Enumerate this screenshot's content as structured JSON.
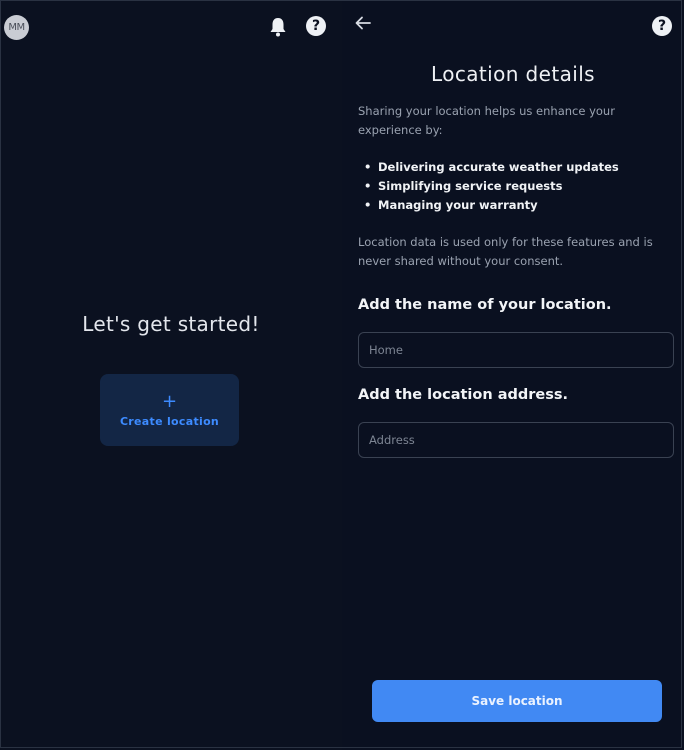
{
  "left_panel": {
    "avatar_initials": "MM",
    "heading": "Let's get started!",
    "create_button": {
      "icon": "plus-icon",
      "label": "Create location"
    }
  },
  "right_panel": {
    "title": "Location details",
    "intro": "Sharing your location helps us enhance your experience by:",
    "bullets": [
      "Delivering accurate weather updates",
      "Simplifying service requests",
      "Managing your warranty"
    ],
    "note": "Location data is used only for these features and is never shared without your consent.",
    "name_section": {
      "label": "Add the name of your location.",
      "placeholder": "Home",
      "value": ""
    },
    "address_section": {
      "label": "Add the location address.",
      "placeholder": "Address",
      "value": ""
    },
    "save_button": "Save location"
  },
  "colors": {
    "background": "#0b1120",
    "accent": "#4189f3",
    "create_button_bg": "#132645"
  }
}
